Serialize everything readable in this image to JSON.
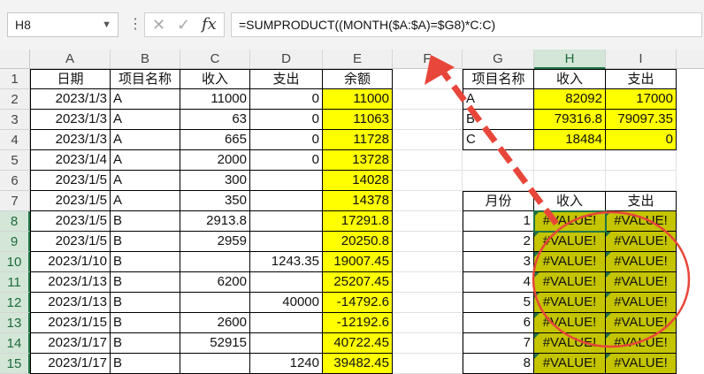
{
  "formula_bar": {
    "name_box": "H8",
    "cancel_glyph": "✕",
    "enter_glyph": "✓",
    "fx_label": "fx",
    "formula": "=SUMPRODUCT((MONTH($A:$A)=$G8)*C:C)"
  },
  "columns": [
    "A",
    "B",
    "C",
    "D",
    "E",
    "F",
    "G",
    "H",
    "I"
  ],
  "rows": [
    "1",
    "2",
    "3",
    "4",
    "5",
    "6",
    "7",
    "8",
    "9",
    "10",
    "11",
    "12",
    "13",
    "14",
    "15"
  ],
  "main_table": {
    "headers": [
      "日期",
      "项目名称",
      "收入",
      "支出",
      "余额"
    ],
    "rows": [
      [
        "2023/1/3",
        "A",
        "11000",
        "0",
        "11000"
      ],
      [
        "2023/1/3",
        "A",
        "63",
        "0",
        "11063"
      ],
      [
        "2023/1/3",
        "A",
        "665",
        "0",
        "11728"
      ],
      [
        "2023/1/4",
        "A",
        "2000",
        "0",
        "13728"
      ],
      [
        "2023/1/5",
        "A",
        "300",
        "",
        "14028"
      ],
      [
        "2023/1/5",
        "A",
        "350",
        "",
        "14378"
      ],
      [
        "2023/1/5",
        "B",
        "2913.8",
        "",
        "17291.8"
      ],
      [
        "2023/1/5",
        "B",
        "2959",
        "",
        "20250.8"
      ],
      [
        "2023/1/10",
        "B",
        "",
        "1243.35",
        "19007.45"
      ],
      [
        "2023/1/13",
        "B",
        "6200",
        "",
        "25207.45"
      ],
      [
        "2023/1/13",
        "B",
        "",
        "40000",
        "-14792.6"
      ],
      [
        "2023/1/15",
        "B",
        "2600",
        "",
        "-12192.6"
      ],
      [
        "2023/1/17",
        "B",
        "52915",
        "",
        "40722.45"
      ],
      [
        "2023/1/17",
        "B",
        "",
        "1240",
        "39482.45"
      ]
    ]
  },
  "summary_by_item": {
    "headers": [
      "项目名称",
      "收入",
      "支出"
    ],
    "rows": [
      [
        "A",
        "82092",
        "17000"
      ],
      [
        "B",
        "79316.8",
        "79097.35"
      ],
      [
        "C",
        "18484",
        "0"
      ]
    ]
  },
  "summary_by_month": {
    "headers": [
      "月份",
      "收入",
      "支出"
    ],
    "rows": [
      [
        "1",
        "#VALUE!",
        "#VALUE!"
      ],
      [
        "2",
        "#VALUE!",
        "#VALUE!"
      ],
      [
        "3",
        "#VALUE!",
        "#VALUE!"
      ],
      [
        "4",
        "#VALUE!",
        "#VALUE!"
      ],
      [
        "5",
        "#VALUE!",
        "#VALUE!"
      ],
      [
        "6",
        "#VALUE!",
        "#VALUE!"
      ],
      [
        "7",
        "#VALUE!",
        "#VALUE!"
      ],
      [
        "8",
        "#VALUE!",
        "#VALUE!"
      ]
    ]
  },
  "colors": {
    "highlight": "#ffff00",
    "error_fill": "#c4c400",
    "selection": "#217346",
    "annotation": "#e8463a"
  },
  "icons": {
    "cancel": "close-icon",
    "enter": "check-icon",
    "insert_function": "fx-icon"
  }
}
